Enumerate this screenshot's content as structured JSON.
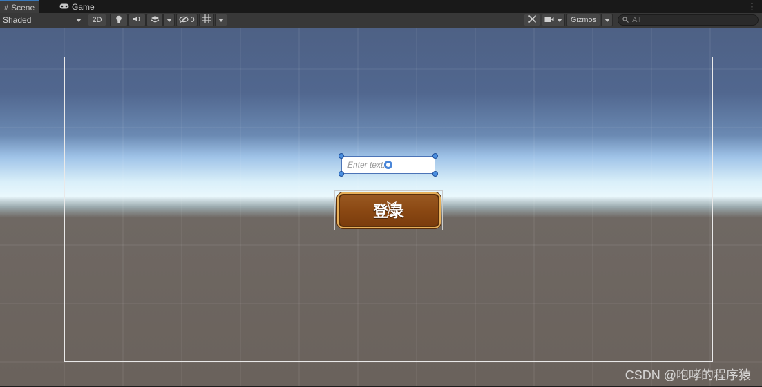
{
  "tabs": [
    {
      "label": "Scene",
      "icon": "grid-icon",
      "active": true
    },
    {
      "label": "Game",
      "icon": "gamepad-icon",
      "active": false
    }
  ],
  "toolbar": {
    "shading_mode": "Shaded",
    "mode_2d_label": "2D",
    "hidden_count": "0",
    "gizmos_label": "Gizmos",
    "search_placeholder": "All"
  },
  "scene": {
    "input_placeholder": "Enter text...",
    "button_label": "登录"
  },
  "watermark": "CSDN @咆哮的程序猿",
  "colors": {
    "accent": "#3a79bb",
    "handle": "#4a8fe0",
    "button_border": "#e7b05a",
    "button_fill": "#8a4813"
  }
}
